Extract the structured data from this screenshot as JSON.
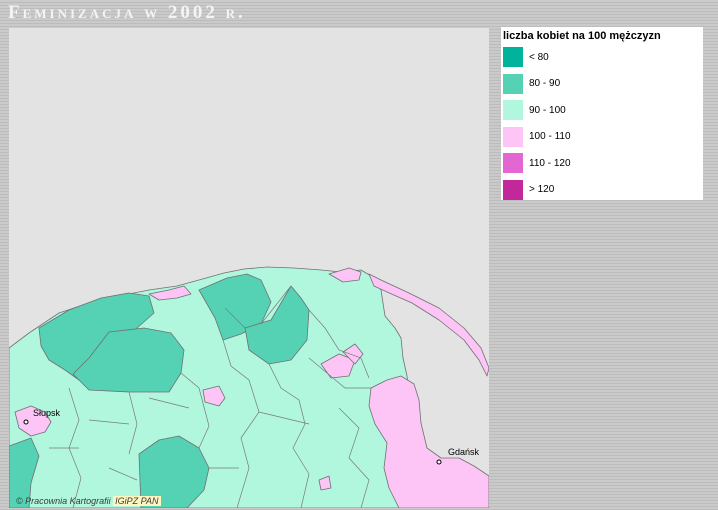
{
  "title": "Feminizacja w 2002 r.",
  "legend": {
    "title": "liczba kobiet na 100 mężczyzn",
    "classes": [
      {
        "label": "< 80",
        "color": "#00b39a"
      },
      {
        "label": "80 - 90",
        "color": "#55d2b3"
      },
      {
        "label": "90 - 100",
        "color": "#b0f7de"
      },
      {
        "label": "100 - 110",
        "color": "#fcc5f5"
      },
      {
        "label": "110 - 120",
        "color": "#e466d2"
      },
      {
        "label": "> 120",
        "color": "#c3289b"
      }
    ]
  },
  "map": {
    "background_color": "#e3e3e3",
    "cities": [
      {
        "name": "Słupsk"
      },
      {
        "name": "Gdańsk"
      }
    ]
  },
  "credit": {
    "prefix": "© Pracownia Kartografii ",
    "highlight": "IGiPZ PAN"
  }
}
